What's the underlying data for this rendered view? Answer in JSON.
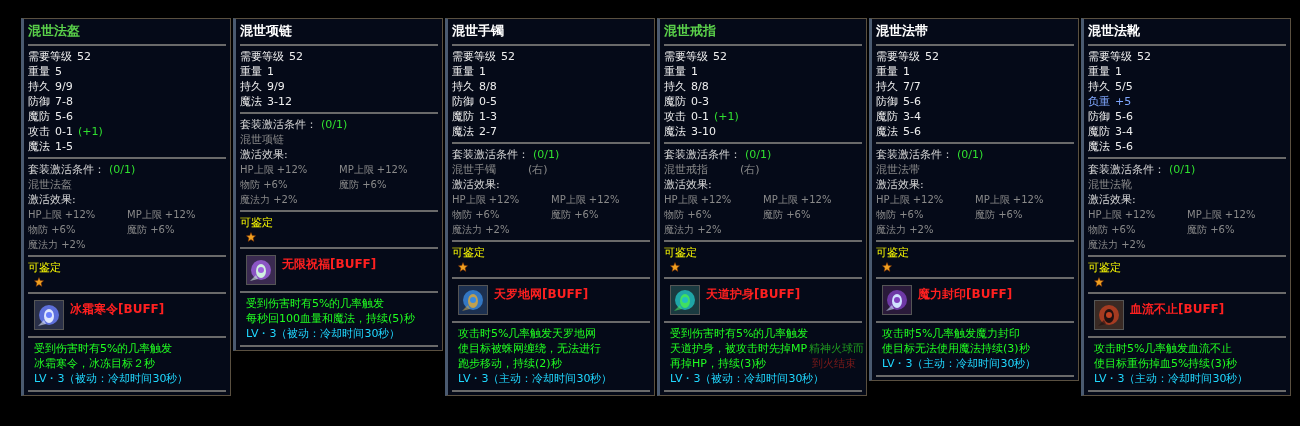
{
  "cards": [
    {
      "title": "混世法盔",
      "highlighted": true,
      "stats": [
        {
          "kind": "base",
          "label": "需要等级",
          "value": "52"
        },
        {
          "kind": "base",
          "label": "重量",
          "value": "5"
        },
        {
          "kind": "base",
          "label": "持久",
          "value": "9/9"
        },
        {
          "kind": "base",
          "label": "防御",
          "value": "7-8"
        },
        {
          "kind": "base",
          "label": "魔防",
          "value": "5-6"
        },
        {
          "kind": "base",
          "label": "攻击",
          "value": "0-1",
          "bonus": "(+1)"
        },
        {
          "kind": "base",
          "label": "魔法",
          "value": "1-5"
        }
      ],
      "set_label": "套装激活条件：",
      "set_progress": "(0/1)",
      "set_piece": "混世法盔",
      "effects_label": "激活效果:",
      "effects": [
        "HP上限 +12%",
        "MP上限 +12%",
        "物防 +6%",
        "魔防 +6%",
        "魔法力 +2%"
      ],
      "identify": "可鉴定",
      "skill": "冰霜寒令[BUFF]",
      "description": [
        "受到伤害时有5%的几率触发",
        "冰霜寒令，冰冻目标２秒"
      ],
      "level_line": "LV・3（被动：冷却时间30秒）"
    },
    {
      "title": "混世项链",
      "highlighted": false,
      "stats": [
        {
          "kind": "base",
          "label": "需要等级",
          "value": "52"
        },
        {
          "kind": "base",
          "label": "重量",
          "value": "1"
        },
        {
          "kind": "base",
          "label": "持久",
          "value": "9/9"
        },
        {
          "kind": "base",
          "label": "魔法",
          "value": "3-12"
        }
      ],
      "set_label": "套装激活条件：",
      "set_progress": "(0/1)",
      "set_piece": "混世项链",
      "effects_label": "激活效果:",
      "effects": [
        "HP上限 +12%",
        "MP上限 +12%",
        "物防 +6%",
        "魔防 +6%",
        "魔法力 +2%"
      ],
      "identify": "可鉴定",
      "skill": "无限祝福[BUFF]",
      "description": [
        "受到伤害时有5%的几率触发",
        "每秒回100血量和魔法，持续(5)秒"
      ],
      "level_line": "LV・3（被动：冷却时间30秒）"
    },
    {
      "title": "混世手镯",
      "highlighted": false,
      "stats": [
        {
          "kind": "base",
          "label": "需要等级",
          "value": "52"
        },
        {
          "kind": "base",
          "label": "重量",
          "value": "1"
        },
        {
          "kind": "base",
          "label": "持久",
          "value": "8/8"
        },
        {
          "kind": "base",
          "label": "防御",
          "value": "0-5"
        },
        {
          "kind": "base",
          "label": "魔防",
          "value": "1-3"
        },
        {
          "kind": "base",
          "label": "魔法",
          "value": "2-7"
        }
      ],
      "set_label": "套装激活条件：",
      "set_progress": "(0/1)",
      "set_piece": "混世手镯",
      "set_side": "(右)",
      "effects_label": "激活效果:",
      "effects": [
        "HP上限 +12%",
        "MP上限 +12%",
        "物防 +6%",
        "魔防 +6%",
        "魔法力 +2%"
      ],
      "identify": "可鉴定",
      "skill": "天罗地网[BUFF]",
      "description": [
        "攻击时5%几率触发天罗地网",
        "使目标被蛛网缠绕，无法进行",
        "跑步移动，持续(2)秒"
      ],
      "level_line": "LV・3（主动：冷却时间30秒）"
    },
    {
      "title": "混世戒指",
      "highlighted": true,
      "stats": [
        {
          "kind": "base",
          "label": "需要等级",
          "value": "52"
        },
        {
          "kind": "base",
          "label": "重量",
          "value": "1"
        },
        {
          "kind": "base",
          "label": "持久",
          "value": "8/8"
        },
        {
          "kind": "base",
          "label": "魔防",
          "value": "0-3"
        },
        {
          "kind": "base",
          "label": "攻击",
          "value": "0-1",
          "bonus": "(+1)"
        },
        {
          "kind": "base",
          "label": "魔法",
          "value": "3-10"
        }
      ],
      "set_label": "套装激活条件：",
      "set_progress": "(0/1)",
      "set_piece": "混世戒指",
      "set_side": "(右)",
      "effects_label": "激活效果:",
      "effects": [
        "HP上限 +12%",
        "MP上限 +12%",
        "物防 +6%",
        "魔防 +6%",
        "魔法力 +2%"
      ],
      "identify": "可鉴定",
      "skill": "天道护身[BUFF]",
      "description": [
        "受到伤害时有5%的几率触发",
        "天道护身，被攻击时先掉MP",
        "再掉HP，持续(3)秒"
      ],
      "overlay": [
        {
          "text": "精神火球而",
          "kind": "hint"
        },
        {
          "text": "到火结束",
          "kind": "warning"
        }
      ],
      "level_line": "LV・3（被动：冷却时间30秒）"
    },
    {
      "title": "混世法带",
      "highlighted": false,
      "stats": [
        {
          "kind": "base",
          "label": "需要等级",
          "value": "52"
        },
        {
          "kind": "base",
          "label": "重量",
          "value": "1"
        },
        {
          "kind": "base",
          "label": "持久",
          "value": "7/7"
        },
        {
          "kind": "base",
          "label": "防御",
          "value": "5-6"
        },
        {
          "kind": "base",
          "label": "魔防",
          "value": "3-4"
        },
        {
          "kind": "base",
          "label": "魔法",
          "value": "5-6"
        }
      ],
      "set_label": "套装激活条件：",
      "set_progress": "(0/1)",
      "set_piece": "混世法带",
      "effects_label": "激活效果:",
      "effects": [
        "HP上限 +12%",
        "MP上限 +12%",
        "物防 +6%",
        "魔防 +6%",
        "魔法力 +2%"
      ],
      "identify": "可鉴定",
      "skill": "魔力封印[BUFF]",
      "description": [
        "攻击时5%几率触发魔力封印",
        "使目标无法使用魔法持续(3)秒"
      ],
      "level_line": "LV・3（主动：冷却时间30秒）"
    },
    {
      "title": "混世法靴",
      "highlighted": false,
      "stats": [
        {
          "kind": "base",
          "label": "需要等级",
          "value": "52"
        },
        {
          "kind": "base",
          "label": "重量",
          "value": "1"
        },
        {
          "kind": "base",
          "label": "持久",
          "value": "5/5"
        },
        {
          "kind": "extra",
          "label": "负重",
          "value": "+5"
        },
        {
          "kind": "base",
          "label": "防御",
          "value": "5-6"
        },
        {
          "kind": "base",
          "label": "魔防",
          "value": "3-4"
        },
        {
          "kind": "base",
          "label": "魔法",
          "value": "5-6"
        }
      ],
      "set_label": "套装激活条件：",
      "set_progress": "(0/1)",
      "set_piece": "混世法靴",
      "effects_label": "激活效果:",
      "effects": [
        "HP上限 +12%",
        "MP上限 +12%",
        "物防 +6%",
        "魔防 +6%",
        "魔法力 +2%"
      ],
      "identify": "可鉴定",
      "skill": "血流不止[BUFF]",
      "description": [
        "攻击时5%几率触发血流不止",
        "使目标重伤掉血5%持续(3)秒"
      ],
      "level_line": "LV・3（主动：冷却时间30秒）"
    }
  ]
}
